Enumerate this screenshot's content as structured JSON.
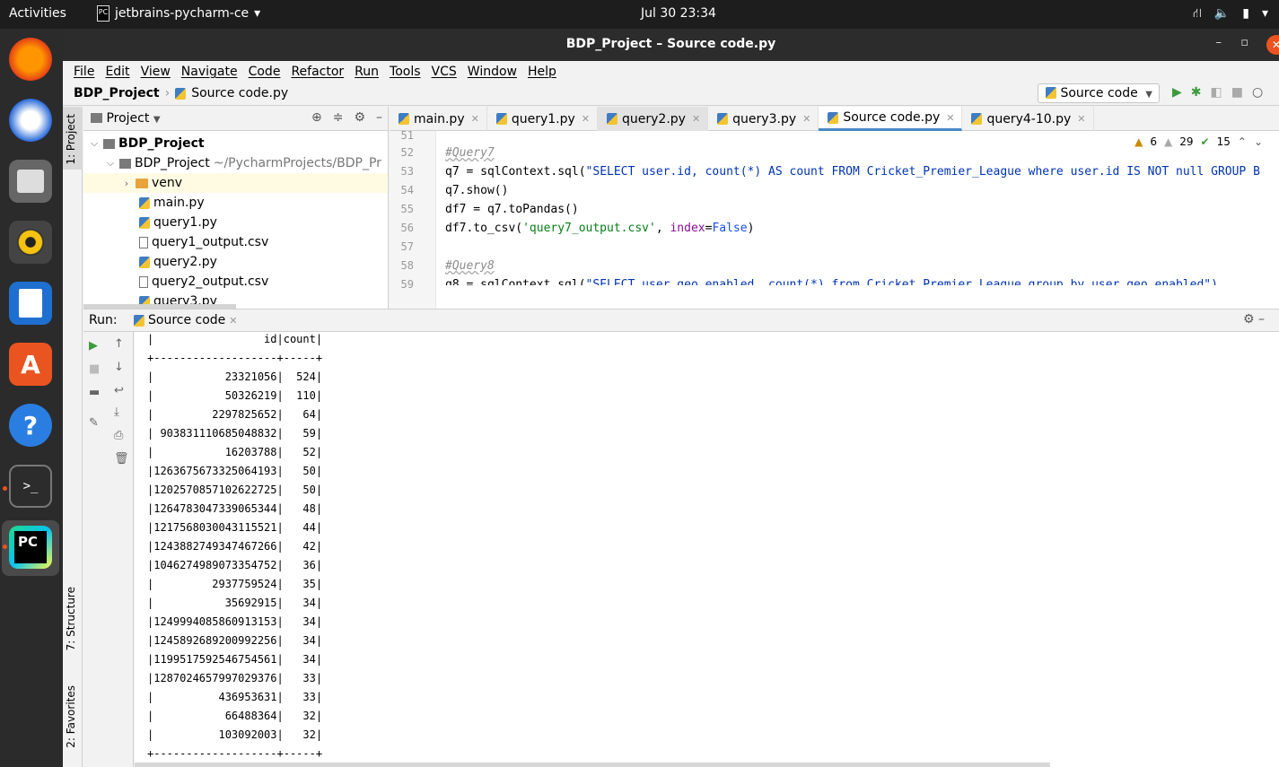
{
  "topbar": {
    "activities": "Activities",
    "app": "jetbrains-pycharm-ce",
    "clock": "Jul 30  23:34"
  },
  "window": {
    "title": "BDP_Project – Source code.py"
  },
  "menu": [
    "File",
    "Edit",
    "View",
    "Navigate",
    "Code",
    "Refactor",
    "Run",
    "Tools",
    "VCS",
    "Window",
    "Help"
  ],
  "navbar": {
    "project": "BDP_Project",
    "file": "Source code.py",
    "run_config": "Source code"
  },
  "side_tabs": {
    "project": "1: Project",
    "structure": "7: Structure",
    "favorites": "2: Favorites"
  },
  "project_panel": {
    "title": "Project",
    "root": "BDP_Project",
    "module": "BDP_Project",
    "module_path": "~/PycharmProjects/BDP_Pr",
    "items": [
      "venv",
      "main.py",
      "query1.py",
      "query1_output.csv",
      "query2.py",
      "query2_output.csv",
      "query3.py"
    ]
  },
  "editor": {
    "tabs": [
      "main.py",
      "query1.py",
      "query2.py",
      "query3.py",
      "Source code.py",
      "query4-10.py"
    ],
    "inspections": {
      "warnings": "6",
      "weak_warnings": "29",
      "ok": "15"
    },
    "line_numbers": [
      "51",
      "52",
      "53",
      "54",
      "55",
      "56",
      "57",
      "58",
      "59"
    ],
    "lines": {
      "l52": "#Query7",
      "l53_a": "q7 = sqlContext.sql(",
      "l53_b": "\"SELECT user.id, count(*) AS count FROM Cricket_Premier_League where user.id IS NOT null GROUP B",
      "l54": "q7.show()",
      "l55": "df7 = q7.toPandas()",
      "l56_a": "df7.to_csv(",
      "l56_b": "'query7_output.csv'",
      "l56_c": ", ",
      "l56_d": "index",
      "l56_e": "=",
      "l56_f": "False",
      "l56_g": ")",
      "l58": "#Query8",
      "l59_a": "q8 = sqlContext.sql(",
      "l59_b": "\"SELECT user.geo_enabled, count(*) from Cricket_Premier_League group by user.geo_enabled\")"
    }
  },
  "run_panel": {
    "label": "Run:",
    "tab": "Source code",
    "console": [
      "|                 id|count|",
      "+-------------------+-----+",
      "|           23321056|  524|",
      "|           50326219|  110|",
      "|         2297825652|   64|",
      "| 903831110685048832|   59|",
      "|           16203788|   52|",
      "|1263675673325064193|   50|",
      "|1202570857102622725|   50|",
      "|1264783047339065344|   48|",
      "|1217568030043115521|   44|",
      "|1243882749347467266|   42|",
      "|1046274989073354752|   36|",
      "|         2937759524|   35|",
      "|           35692915|   34|",
      "|1249994085860913153|   34|",
      "|1245892689200992256|   34|",
      "|1199517592546754561|   34|",
      "|1287024657997029376|   33|",
      "|          436953631|   33|",
      "|           66488364|   32|",
      "|          103092003|   32|",
      "+-------------------+-----+"
    ]
  }
}
